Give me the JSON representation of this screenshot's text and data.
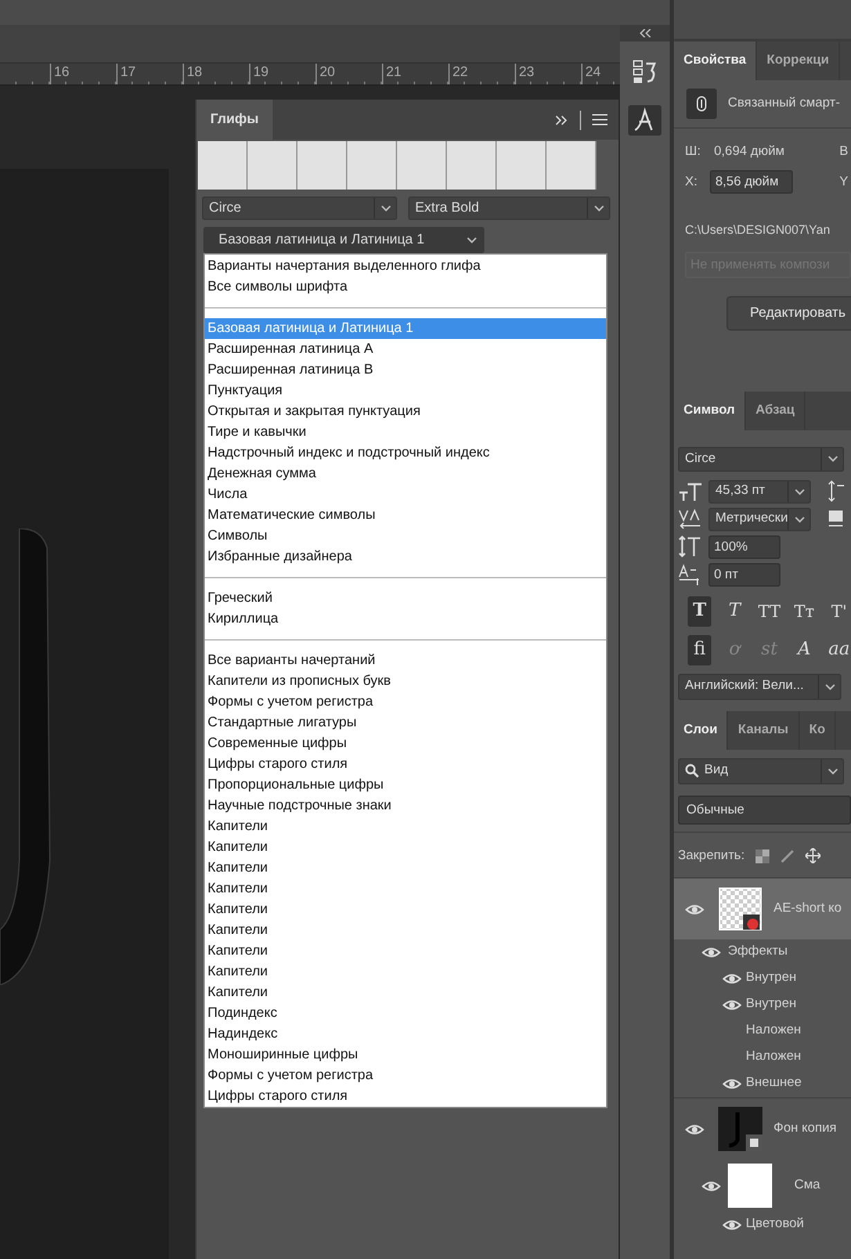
{
  "ruler": {
    "ticks": [
      "16",
      "17",
      "18",
      "19",
      "20",
      "21",
      "22",
      "23",
      "24"
    ]
  },
  "glyphs_panel": {
    "title": "Глифы",
    "font_family": "Circe",
    "font_style": "Extra Bold",
    "category": "Базовая латиница и Латиница 1",
    "menu": [
      {
        "kind": "item",
        "label": "Варианты начертания выделенного глифа",
        "selected": false
      },
      {
        "kind": "item",
        "label": "Все символы шрифта",
        "selected": false
      },
      {
        "kind": "separator"
      },
      {
        "kind": "item",
        "label": "Базовая латиница и Латиница 1",
        "selected": true
      },
      {
        "kind": "item",
        "label": "Расширенная латиница A",
        "selected": false
      },
      {
        "kind": "item",
        "label": "Расширенная латиница B",
        "selected": false
      },
      {
        "kind": "item",
        "label": "Пунктуация",
        "selected": false
      },
      {
        "kind": "item",
        "label": "Открытая и закрытая пунктуация",
        "selected": false
      },
      {
        "kind": "item",
        "label": "Тире и кавычки",
        "selected": false
      },
      {
        "kind": "item",
        "label": "Надстрочный индекс и подстрочный индекс",
        "selected": false
      },
      {
        "kind": "item",
        "label": "Денежная сумма",
        "selected": false
      },
      {
        "kind": "item",
        "label": "Числа",
        "selected": false
      },
      {
        "kind": "item",
        "label": "Математические символы",
        "selected": false
      },
      {
        "kind": "item",
        "label": "Символы",
        "selected": false
      },
      {
        "kind": "item",
        "label": "Избранные дизайнера",
        "selected": false
      },
      {
        "kind": "separator"
      },
      {
        "kind": "item",
        "label": "Греческий",
        "selected": false
      },
      {
        "kind": "item",
        "label": "Кириллица",
        "selected": false
      },
      {
        "kind": "separator"
      },
      {
        "kind": "item",
        "label": "Все варианты начертаний",
        "selected": false
      },
      {
        "kind": "item",
        "label": "Капители из прописных букв",
        "selected": false
      },
      {
        "kind": "item",
        "label": "Формы с учетом регистра",
        "selected": false
      },
      {
        "kind": "item",
        "label": "Стандартные лигатуры",
        "selected": false
      },
      {
        "kind": "item",
        "label": "Современные цифры",
        "selected": false
      },
      {
        "kind": "item",
        "label": "Цифры старого стиля",
        "selected": false
      },
      {
        "kind": "item",
        "label": "Пропорциональные цифры",
        "selected": false
      },
      {
        "kind": "item",
        "label": "Научные подстрочные знаки",
        "selected": false
      },
      {
        "kind": "item",
        "label": "Капители",
        "selected": false
      },
      {
        "kind": "item",
        "label": "Капители",
        "selected": false
      },
      {
        "kind": "item",
        "label": "Капители",
        "selected": false
      },
      {
        "kind": "item",
        "label": "Капители",
        "selected": false
      },
      {
        "kind": "item",
        "label": "Капители",
        "selected": false
      },
      {
        "kind": "item",
        "label": "Капители",
        "selected": false
      },
      {
        "kind": "item",
        "label": "Капители",
        "selected": false
      },
      {
        "kind": "item",
        "label": "Капители",
        "selected": false
      },
      {
        "kind": "item",
        "label": "Капители",
        "selected": false
      },
      {
        "kind": "item",
        "label": "Подиндекс",
        "selected": false
      },
      {
        "kind": "item",
        "label": "Надиндекс",
        "selected": false
      },
      {
        "kind": "item",
        "label": "Моноширинные цифры",
        "selected": false
      },
      {
        "kind": "item",
        "label": "Формы с учетом регистра",
        "selected": false
      },
      {
        "kind": "item",
        "label": "Цифры старого стиля",
        "selected": false
      }
    ]
  },
  "properties": {
    "tabs": [
      {
        "label": "Свойства",
        "selected": true
      },
      {
        "label": "Коррекци",
        "selected": false
      }
    ],
    "layer_type": "Связанный смарт-",
    "width_label": "Ш:",
    "width_value": "0,694 дюйм",
    "height_label": "В",
    "x_label": "X:",
    "x_value": "8,56 дюйм",
    "y_label": "Y",
    "path": "C:\\Users\\DESIGN007\\Yan",
    "comp_placeholder": "Не применять компози",
    "edit_button": "Редактировать"
  },
  "character": {
    "tabs": [
      {
        "label": "Символ",
        "selected": true
      },
      {
        "label": "Абзац",
        "selected": false
      }
    ],
    "font": "Circe",
    "size": "45,33 пт",
    "kerning": "Метрически",
    "leading": "100%",
    "baseline_shift": "0 пт",
    "style_buttons": [
      {
        "kind": "bold",
        "label": "T",
        "selected": true
      },
      {
        "kind": "italic",
        "label": "T",
        "selected": false
      },
      {
        "kind": "caps",
        "label": "TT",
        "selected": false
      },
      {
        "kind": "small-caps",
        "label": "Tт",
        "selected": false
      },
      {
        "kind": "super",
        "label": "T'",
        "selected": false
      }
    ],
    "opentype_buttons": [
      {
        "label": "fi",
        "selected": true,
        "disabled": false
      },
      {
        "label": "ơ",
        "selected": false,
        "disabled": true
      },
      {
        "label": "st",
        "selected": false,
        "disabled": true
      },
      {
        "label": "A",
        "selected": false,
        "disabled": false
      },
      {
        "label": "aa",
        "selected": false,
        "disabled": false
      }
    ],
    "language": "Английский: Вели..."
  },
  "layers": {
    "tabs": [
      {
        "label": "Слои",
        "selected": true
      },
      {
        "label": "Каналы",
        "selected": false
      },
      {
        "label": "Ко",
        "selected": false
      }
    ],
    "filter": "Вид",
    "blend_mode": "Обычные",
    "lock_label": "Закрепить:",
    "items": [
      {
        "name": "AE-short ко",
        "kind": "transparent",
        "selected": true,
        "visible": true,
        "children": [
          {
            "name": "Эффекты",
            "visible": true,
            "children": [
              {
                "name": "Внутрен",
                "visible": true
              },
              {
                "name": "Внутрен",
                "visible": true
              },
              {
                "name": "Наложен",
                "visible": false
              },
              {
                "name": "Наложен",
                "visible": false
              },
              {
                "name": "Внешнее",
                "visible": true
              }
            ]
          }
        ]
      },
      {
        "name": "Фон копия",
        "kind": "dark",
        "selected": false,
        "visible": true,
        "children": [
          {
            "name": "Сма",
            "kind": "mask",
            "visible": true,
            "children": [
              {
                "name": "Цветовой",
                "visible": true
              }
            ]
          }
        ]
      }
    ]
  }
}
